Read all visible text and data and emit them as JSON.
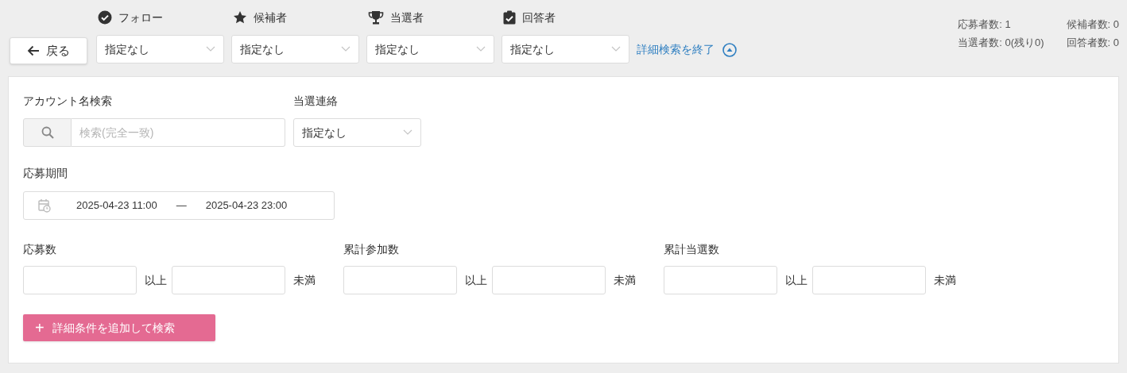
{
  "back_button": {
    "label": "戻る"
  },
  "filters": [
    {
      "kind": "check",
      "label": "フォロー",
      "value": "指定なし"
    },
    {
      "kind": "star",
      "label": "候補者",
      "value": "指定なし"
    },
    {
      "kind": "trophy",
      "label": "当選者",
      "value": "指定なし"
    },
    {
      "kind": "clipboard",
      "label": "回答者",
      "value": "指定なし"
    }
  ],
  "close_advanced_link": "詳細検索を終了",
  "stats": [
    "応募者数: 1",
    "候補者数: 0",
    "当選者数: 0(残り0)",
    "回答者数: 0"
  ],
  "account_search": {
    "label": "アカウント名検索",
    "placeholder": "検索(完全一致)"
  },
  "winner_contact": {
    "label": "当選連絡",
    "value": "指定なし"
  },
  "period": {
    "label": "応募期間",
    "start": "2025-04-23 11:00",
    "separator": "—",
    "end": "2025-04-23 23:00"
  },
  "ranges": [
    {
      "label": "応募数",
      "min_suffix": "以上",
      "max_suffix": "未満"
    },
    {
      "label": "累計参加数",
      "min_suffix": "以上",
      "max_suffix": "未満"
    },
    {
      "label": "累計当選数",
      "min_suffix": "以上",
      "max_suffix": "未満"
    }
  ],
  "submit_button": {
    "icon": "+",
    "label": "詳細条件を追加して検索"
  }
}
